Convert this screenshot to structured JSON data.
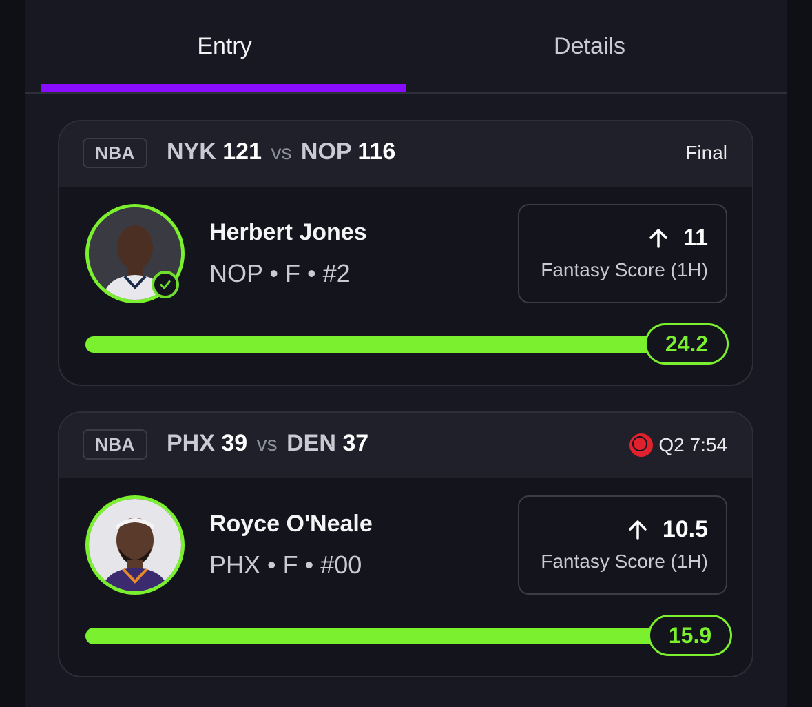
{
  "tabs": {
    "entry": "Entry",
    "details": "Details"
  },
  "cards": [
    {
      "league": "NBA",
      "away_team": "NYK",
      "away_score": "121",
      "vs": "vs",
      "home_team": "NOP",
      "home_score": "116",
      "status": "Final",
      "player_name": "Herbert Jones",
      "player_meta": "NOP • F • #2",
      "projection": "11",
      "stat_label": "Fantasy Score (1H)",
      "actual": "24.2",
      "progress": 1.0
    },
    {
      "league": "NBA",
      "away_team": "PHX",
      "away_score": "39",
      "vs": "vs",
      "home_team": "DEN",
      "home_score": "37",
      "status": "Q2 7:54",
      "player_name": "Royce O'Neale",
      "player_meta": "PHX • F • #00",
      "projection": "10.5",
      "stat_label": "Fantasy Score (1H)",
      "actual": "15.9",
      "progress": 1.0
    }
  ],
  "colors": {
    "accent": "#8a0cff",
    "success": "#7bf02e",
    "live": "#e1222e"
  }
}
